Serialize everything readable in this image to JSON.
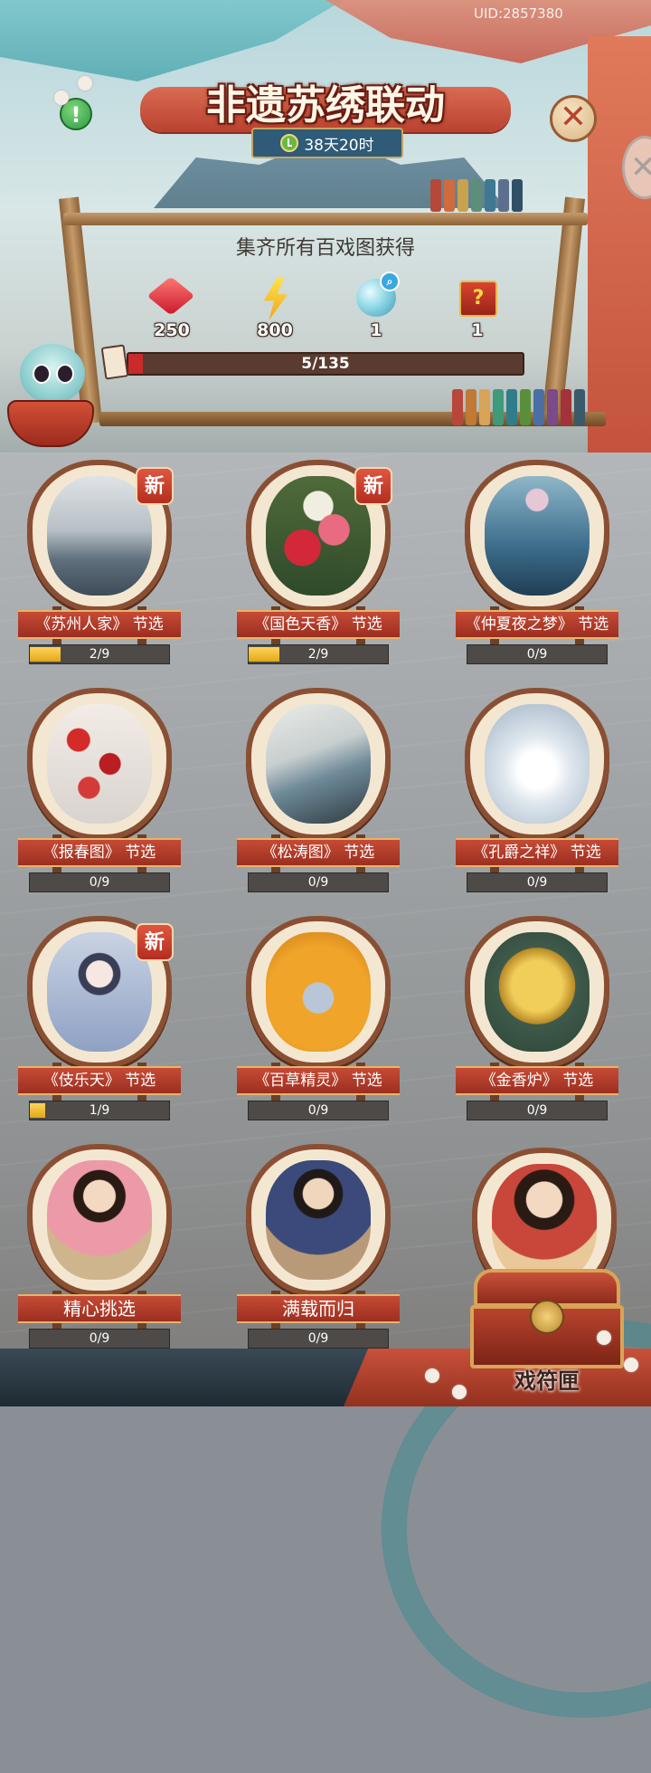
{
  "header": {
    "uid": "UID:2857380",
    "title": "非遗苏绣联动",
    "timer": "38天20时"
  },
  "rewards": {
    "caption": "集齐所有百戏图获得",
    "items": [
      {
        "icon": "red-gem-icon",
        "count": "250"
      },
      {
        "icon": "lightning-bolt-icon",
        "count": "800"
      },
      {
        "icon": "magic-orb-icon",
        "count": "1"
      },
      {
        "icon": "mystery-box-icon",
        "count": "1"
      }
    ],
    "progress_label": "5/135",
    "progress_fraction": 0.037
  },
  "cards": [
    {
      "name": "《苏州人家》 节选",
      "progress": "2/9",
      "fraction": 0.222,
      "new": true,
      "new_label": "新",
      "art": "suzhou-village-art"
    },
    {
      "name": "《国色天香》 节选",
      "progress": "2/9",
      "fraction": 0.222,
      "new": true,
      "new_label": "新",
      "art": "peony-art"
    },
    {
      "name": "《仲夏夜之梦》 节选",
      "progress": "0/9",
      "fraction": 0,
      "new": false,
      "art": "lotus-art"
    },
    {
      "name": "《报春图》 节选",
      "progress": "0/9",
      "fraction": 0,
      "new": false,
      "art": "plum-blossom-art"
    },
    {
      "name": "《松涛图》 节选",
      "progress": "0/9",
      "fraction": 0,
      "new": false,
      "art": "pine-cranes-art"
    },
    {
      "name": "《孔爵之祥》 节选",
      "progress": "0/9",
      "fraction": 0,
      "new": false,
      "art": "white-peacock-art"
    },
    {
      "name": "《伎乐天》 节选",
      "progress": "1/9",
      "fraction": 0.111,
      "new": true,
      "new_label": "新",
      "art": "celestial-dancer-art"
    },
    {
      "name": "《百草精灵》 节选",
      "progress": "0/9",
      "fraction": 0,
      "new": false,
      "art": "golden-monkey-art"
    },
    {
      "name": "《金香炉》 节选",
      "progress": "0/9",
      "fraction": 0,
      "new": false,
      "art": "golden-censer-art"
    },
    {
      "name": "精心挑选",
      "progress": "0/9",
      "fraction": 0,
      "new": false,
      "art": "lady-portrait-art"
    },
    {
      "name": "满载而归",
      "progress": "0/9",
      "fraction": 0,
      "new": false,
      "art": "swordsman-portrait-art"
    }
  ],
  "chest": {
    "label": "戏符匣",
    "art": "noblewoman-portrait-art"
  },
  "colors": {
    "accent_red": "#b9422f",
    "progress_gold": "#ffd45a",
    "progress_red": "#c92a2a"
  }
}
